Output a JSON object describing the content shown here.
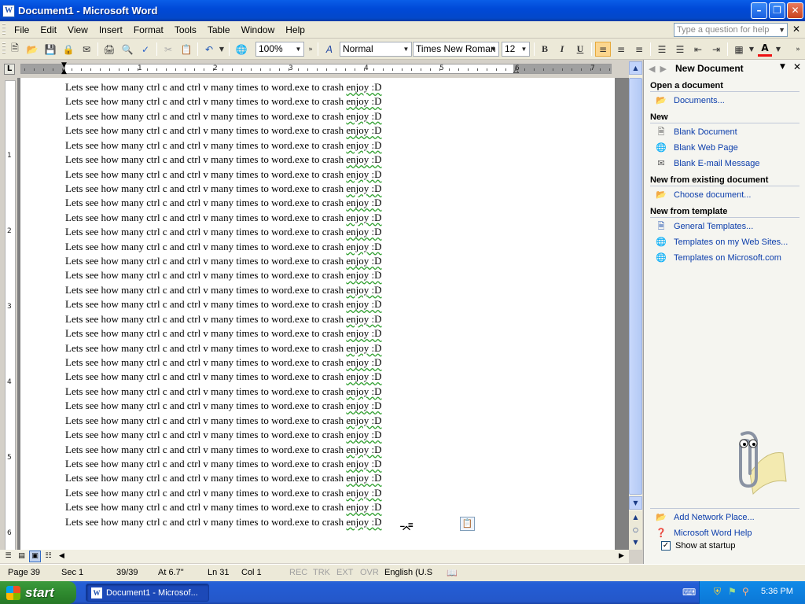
{
  "window": {
    "title": "Document1 - Microsoft Word",
    "icon": "W"
  },
  "menu": [
    "File",
    "Edit",
    "View",
    "Insert",
    "Format",
    "Tools",
    "Table",
    "Window",
    "Help"
  ],
  "help_box": {
    "placeholder": "Type a question for help"
  },
  "toolbar": {
    "zoom": "100%",
    "style": "Normal",
    "font": "Times New Roman",
    "size": "12",
    "bold": "B",
    "italic": "I",
    "underline": "U"
  },
  "ruler": {
    "numbers": [
      "1",
      "2",
      "3",
      "4",
      "5",
      "6",
      "7"
    ]
  },
  "vertical_ruler": {
    "numbers": [
      "1",
      "2",
      "3",
      "4",
      "5",
      "6"
    ]
  },
  "document": {
    "lines": [
      "Lets see how many ctrl c and ctrl v many times to word.exe to crash enjoy :D",
      "Lets see how many ctrl c and ctrl v many times to word.exe to crash enjoy :D",
      "Lets see how many ctrl c and ctrl v many times to word.exe to crash enjoy :D",
      "Lets see how many ctrl c and ctrl v many times to word.exe to crash enjoy :D",
      "Lets see how many ctrl c and ctrl v many times to word.exe to crash enjoy :D",
      "Lets see how many ctrl c and ctrl v many times to word.exe to crash enjoy :D",
      "Lets see how many ctrl c and ctrl v many times to word.exe to crash enjoy :D",
      "Lets see how many ctrl c and ctrl v many times to word.exe to crash enjoy :D",
      "Lets see how many ctrl c and ctrl v many times to word.exe to crash enjoy :D",
      "Lets see how many ctrl c and ctrl v many times to word.exe to crash enjoy :D",
      "Lets see how many ctrl c and ctrl v many times to word.exe to crash enjoy :D",
      "Lets see how many ctrl c and ctrl v many times to word.exe to crash enjoy :D",
      "Lets see how many ctrl c and ctrl v many times to word.exe to crash enjoy :D",
      "Lets see how many ctrl c and ctrl v many times to word.exe to crash enjoy :D",
      "Lets see how many ctrl c and ctrl v many times to word.exe to crash enjoy :D",
      "Lets see how many ctrl c and ctrl v many times to word.exe to crash enjoy :D",
      "Lets see how many ctrl c and ctrl v many times to word.exe to crash enjoy :D",
      "Lets see how many ctrl c and ctrl v many times to word.exe to crash enjoy :D",
      "Lets see how many ctrl c and ctrl v many times to word.exe to crash enjoy :D",
      "Lets see how many ctrl c and ctrl v many times to word.exe to crash enjoy :D",
      "Lets see how many ctrl c and ctrl v many times to word.exe to crash enjoy :D",
      "Lets see how many ctrl c and ctrl v many times to word.exe to crash enjoy :D",
      "Lets see how many ctrl c and ctrl v many times to word.exe to crash enjoy :D",
      "Lets see how many ctrl c and ctrl v many times to word.exe to crash enjoy :D",
      "Lets see how many ctrl c and ctrl v many times to word.exe to crash enjoy :D",
      "Lets see how many ctrl c and ctrl v many times to word.exe to crash enjoy :D",
      "Lets see how many ctrl c and ctrl v many times to word.exe to crash enjoy :D",
      "Lets see how many ctrl c and ctrl v many times to word.exe to crash enjoy :D",
      "Lets see how many ctrl c and ctrl v many times to word.exe to crash enjoy :D",
      "Lets see how many ctrl c and ctrl v many times to word.exe to crash enjoy :D",
      "Lets see how many ctrl c and ctrl v many times to word.exe to crash enjoy :D"
    ]
  },
  "status": {
    "page": "Page 39",
    "section": "Sec 1",
    "pages": "39/39",
    "at": "At 6.7\"",
    "ln": "Ln 31",
    "col": "Col 1",
    "rec": "REC",
    "trk": "TRK",
    "ext": "EXT",
    "ovr": "OVR",
    "language": "English (U.S"
  },
  "task_pane": {
    "title": "New Document",
    "sections": {
      "open": "Open a document",
      "new": "New",
      "existing": "New from existing document",
      "template": "New from template"
    },
    "links": {
      "documents": "Documents...",
      "blank_document": "Blank Document",
      "blank_web_page": "Blank Web Page",
      "blank_email": "Blank E-mail Message",
      "choose_document": "Choose document...",
      "general_templates": "General Templates...",
      "templates_web_sites": "Templates on my Web Sites...",
      "templates_microsoft": "Templates on Microsoft.com",
      "add_network_place": "Add Network Place...",
      "word_help": "Microsoft Word Help"
    },
    "show_at_startup": "Show at startup",
    "show_at_startup_checked": true
  },
  "taskbar": {
    "start": "start",
    "task_button": "Document1 - Microsof...",
    "clock": "5:36 PM"
  }
}
